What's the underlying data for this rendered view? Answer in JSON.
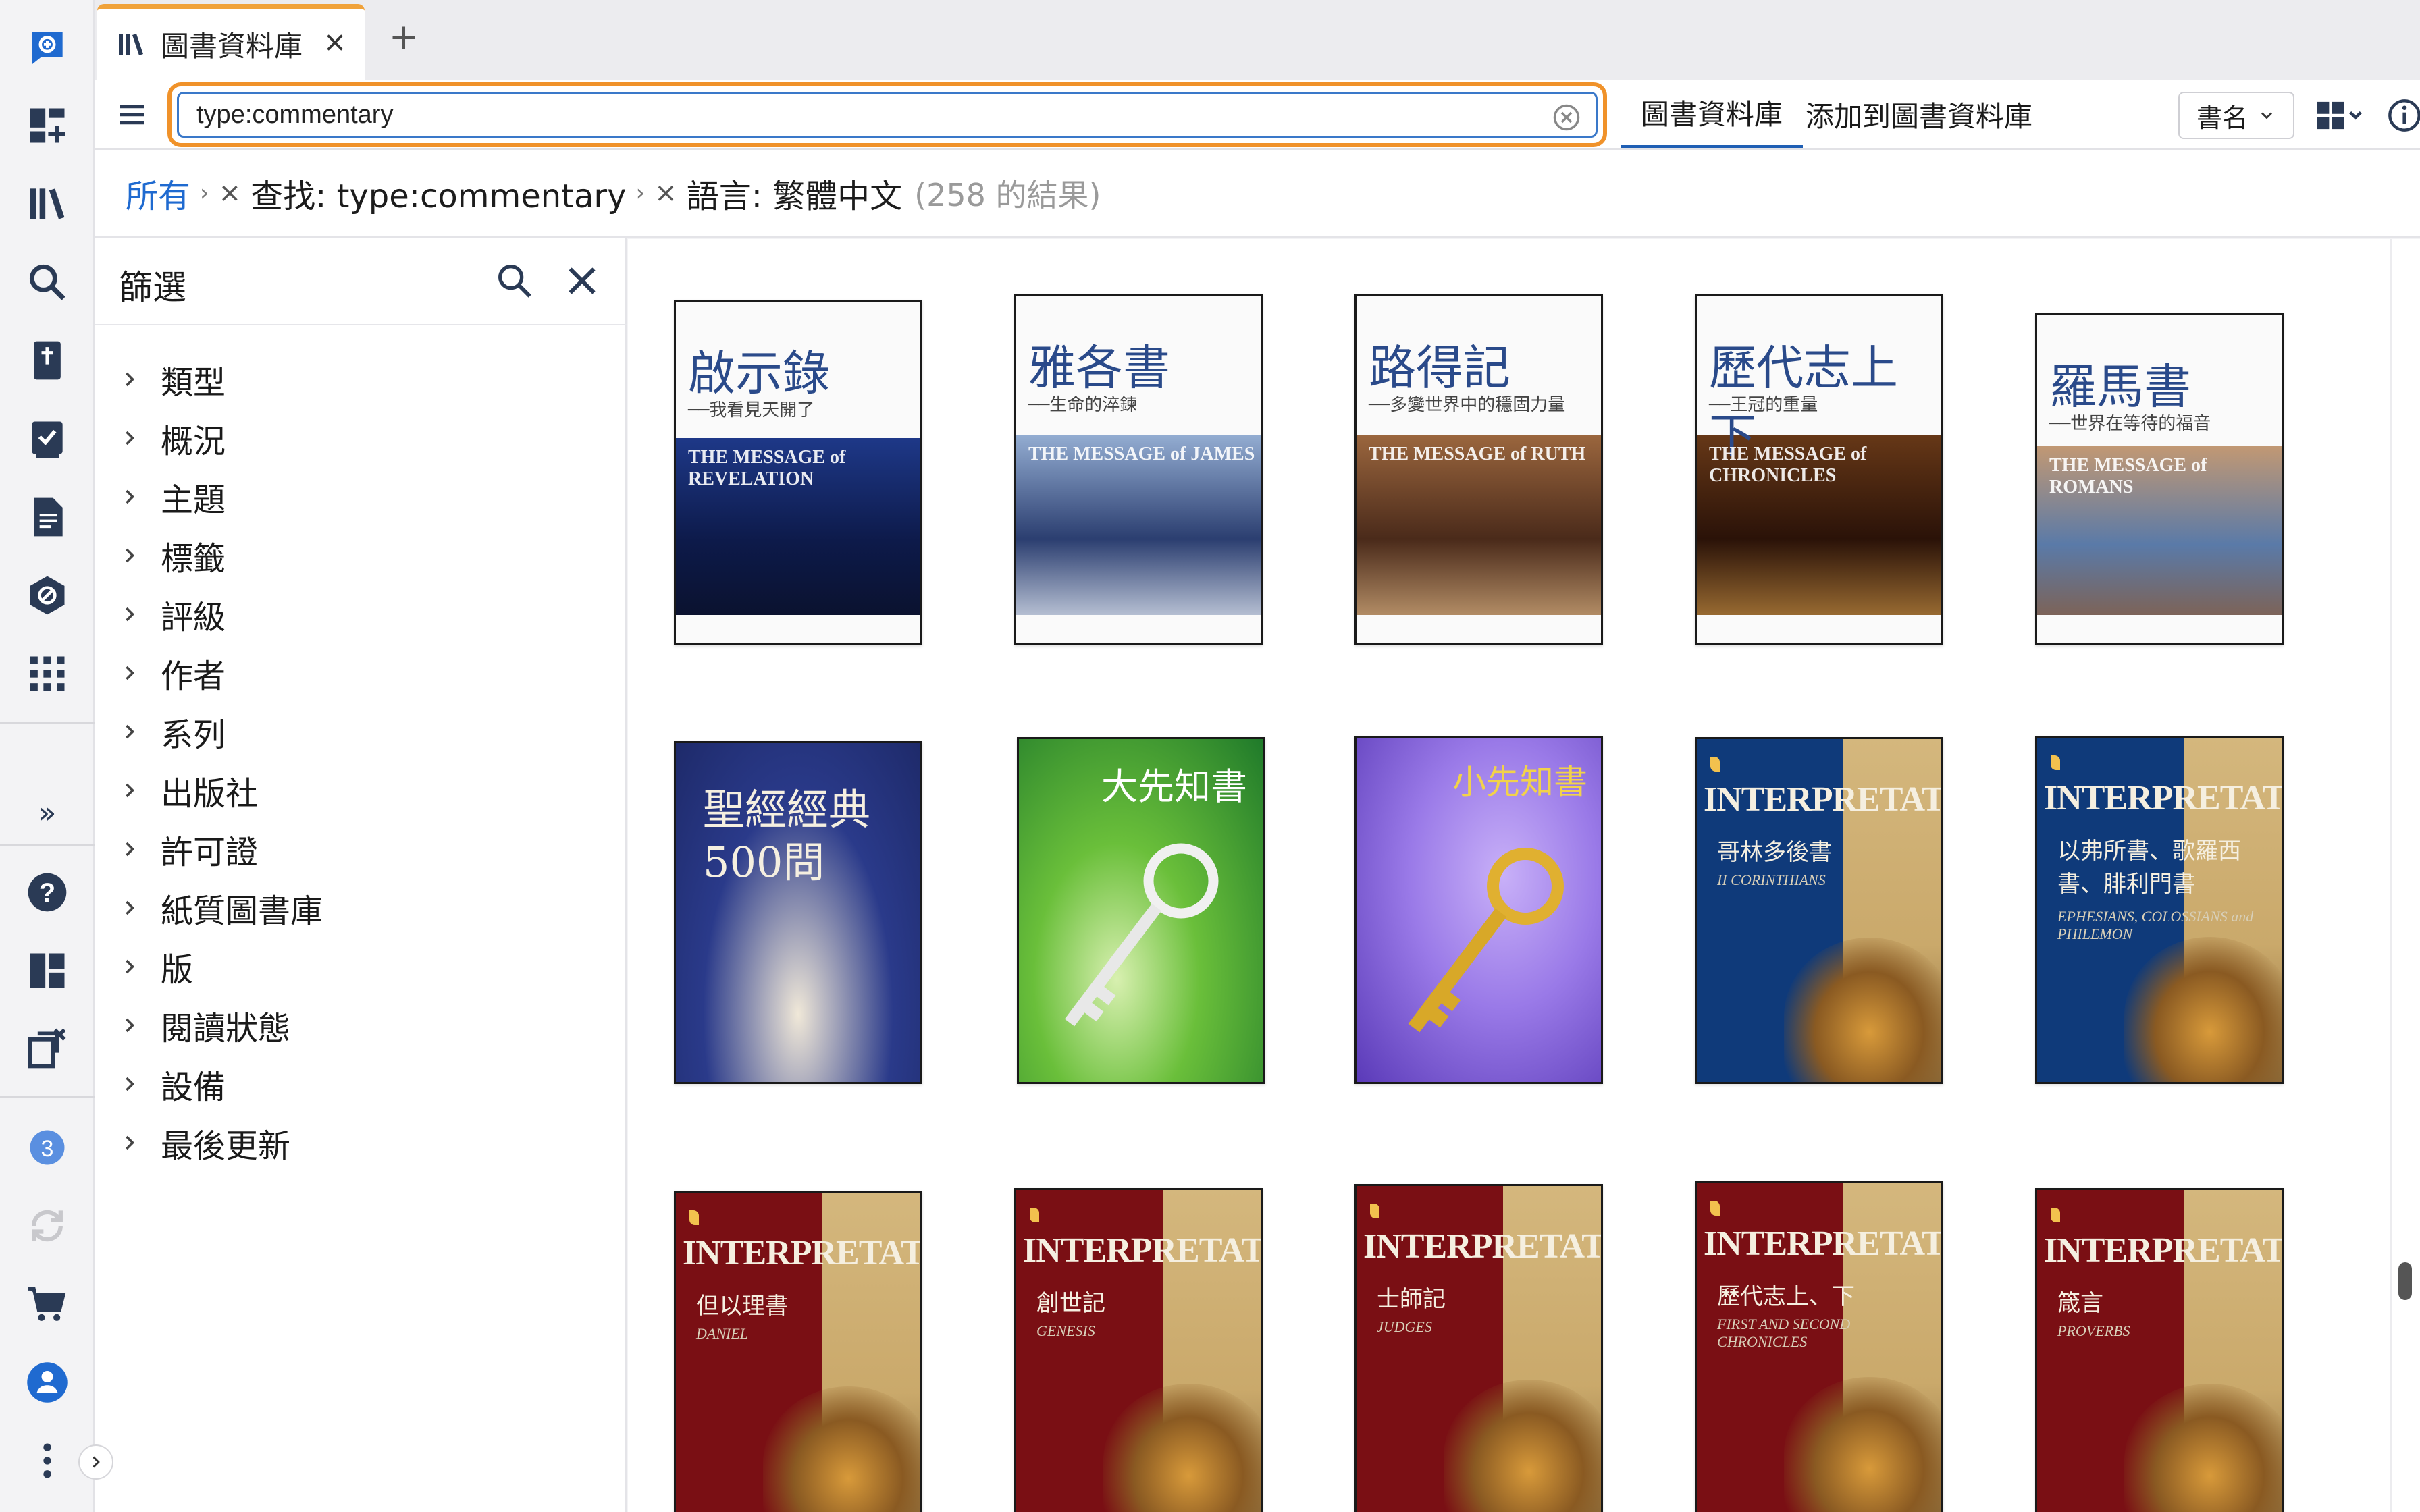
{
  "rail": {
    "items": [
      {
        "name": "app-logo-icon"
      },
      {
        "name": "dashboard-add-icon"
      },
      {
        "name": "library-icon"
      },
      {
        "name": "search-icon"
      },
      {
        "name": "bible-icon"
      },
      {
        "name": "checklist-icon"
      },
      {
        "name": "document-icon"
      },
      {
        "name": "atlas-icon"
      },
      {
        "name": "apps-grid-icon"
      }
    ],
    "expand_glyph": "»",
    "bottom_items": [
      {
        "name": "help-icon"
      },
      {
        "name": "layout-icon"
      },
      {
        "name": "close-panels-icon"
      }
    ],
    "notification_count": "3"
  },
  "tab": {
    "label": "圖書資料庫"
  },
  "toolbar": {
    "search_value": "type:commentary",
    "library_tab": "圖書資料庫",
    "add_to_library": "添加到圖書資料庫",
    "sort_label": "書名"
  },
  "breadcrumb": {
    "all": "所有",
    "sep": "›",
    "x": "×",
    "search": "查找: type:commentary",
    "language": "語言: 繁體中文",
    "count": "(258 的結果)"
  },
  "filter": {
    "title": "篩選",
    "facets": [
      "類型",
      "概況",
      "主題",
      "標籤",
      "評級",
      "作者",
      "系列",
      "出版社",
      "許可證",
      "紙質圖書庫",
      "版",
      "閱讀狀態",
      "設備",
      "最後更新"
    ]
  },
  "books": [
    {
      "title": "啟示錄",
      "subtitle": "──我看見天開了",
      "eng": "THE MESSAGE of REVELATION",
      "style": "wb",
      "colors": [
        "#0d1a4a",
        "#1f3a8c",
        "#0a0f25"
      ]
    },
    {
      "title": "雅各書",
      "subtitle": "──生命的淬鍊",
      "eng": "THE MESSAGE of JAMES",
      "style": "wb",
      "colors": [
        "#2b3e70",
        "#9ab4d8",
        "#e8eef6"
      ]
    },
    {
      "title": "路得記",
      "subtitle": "──多變世界中的穩固力量",
      "eng": "THE MESSAGE of RUTH",
      "style": "wb",
      "colors": [
        "#4a2a1a",
        "#a06a40",
        "#d8b080"
      ]
    },
    {
      "title": "歷代志上下",
      "subtitle": "──王冠的重量",
      "eng": "THE MESSAGE of CHRONICLES",
      "style": "wb",
      "colors": [
        "#2a1208",
        "#6a3a18",
        "#c08a40"
      ]
    },
    {
      "title": "羅馬書",
      "subtitle": "──世界在等待的福音",
      "eng": "THE MESSAGE of ROMANS",
      "style": "wb",
      "colors": [
        "#5a7aa8",
        "#c89a70",
        "#8a5a38"
      ]
    },
    {
      "title": "聖經經典500問",
      "subtitle": "",
      "eng": "",
      "style": "navy",
      "colors": [
        "#2a3a8a",
        "#1e2a6a",
        "#f0e8d8"
      ]
    },
    {
      "title": "大先知書",
      "subtitle": "",
      "eng": "",
      "style": "green",
      "colors": [
        "#1f7a2a",
        "#6abf3a",
        "#d8f0b0"
      ]
    },
    {
      "title": "小先知書",
      "subtitle": "",
      "eng": "",
      "style": "purple",
      "colors": [
        "#5a3ab8",
        "#9a7ae8",
        "#c8b0f8"
      ]
    },
    {
      "title": "哥林多後書",
      "subtitle": "",
      "eng": "INTERPRETATION",
      "eng2": "II CORINTHIANS",
      "style": "ip",
      "colors": [
        "#0f3a7a",
        "#1a4a90"
      ]
    },
    {
      "title": "以弗所書、歌羅西書、腓利門書",
      "subtitle": "",
      "eng": "INTERPRETATION",
      "eng2": "EPHESIANS, COLOSSIANS and PHILEMON",
      "style": "ip",
      "colors": [
        "#0f3a7a",
        "#1a4a90"
      ]
    },
    {
      "title": "但以理書",
      "subtitle": "",
      "eng": "INTERPRETATION",
      "eng2": "DANIEL",
      "style": "ip",
      "colors": [
        "#7a0f14",
        "#8a1a1e"
      ]
    },
    {
      "title": "創世記",
      "subtitle": "",
      "eng": "INTERPRETATION",
      "eng2": "GENESIS",
      "style": "ip",
      "colors": [
        "#7a0f14",
        "#8a1a1e"
      ]
    },
    {
      "title": "士師記",
      "subtitle": "",
      "eng": "INTERPRETATION",
      "eng2": "JUDGES",
      "style": "ip",
      "colors": [
        "#7a0f14",
        "#8a1a1e"
      ]
    },
    {
      "title": "歷代志上、下",
      "subtitle": "",
      "eng": "INTERPRETATION",
      "eng2": "FIRST AND SECOND CHRONICLES",
      "style": "ip",
      "colors": [
        "#7a0f14",
        "#8a1a1e"
      ]
    },
    {
      "title": "箴言",
      "subtitle": "",
      "eng": "INTERPRETATION",
      "eng2": "PROVERBS",
      "style": "ip",
      "colors": [
        "#7a0f14",
        "#8a1a1e"
      ]
    }
  ]
}
